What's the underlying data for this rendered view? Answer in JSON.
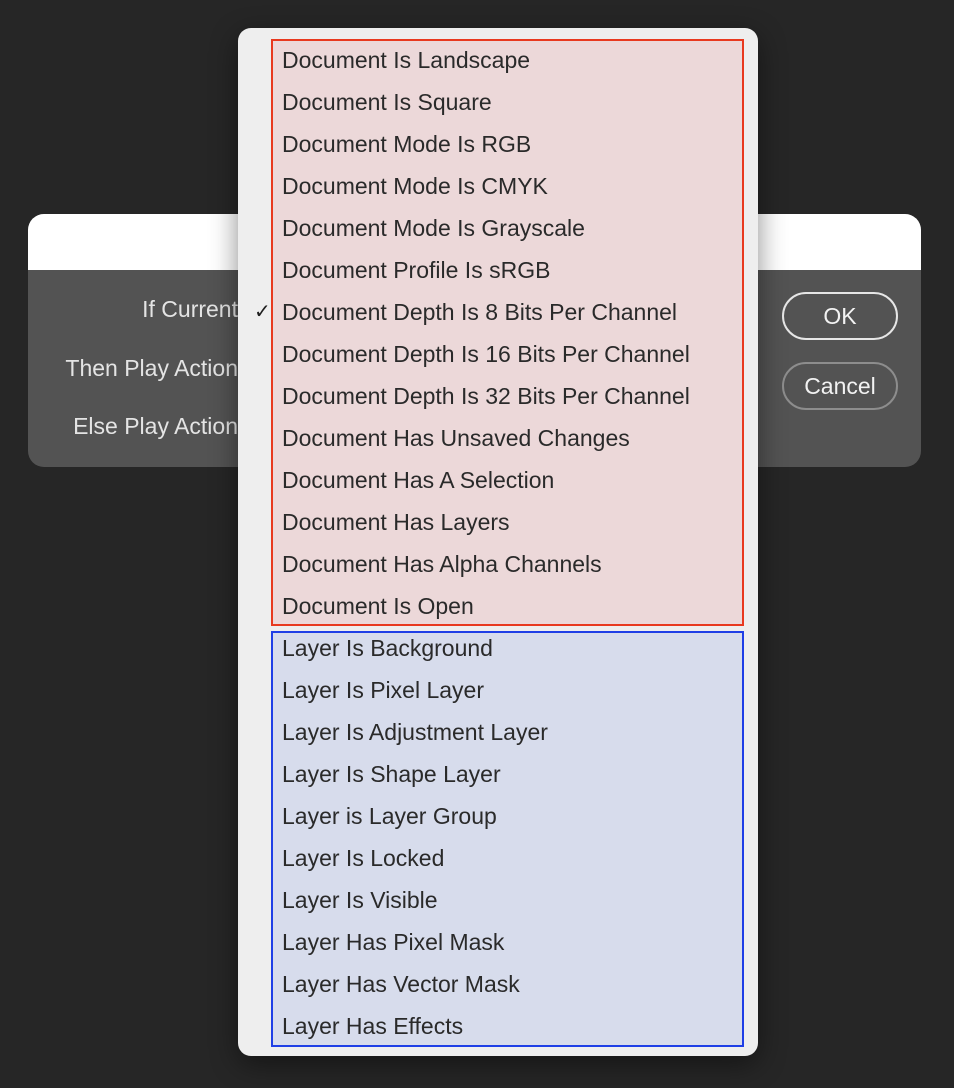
{
  "dialog": {
    "labels": {
      "if_current": "If Current",
      "then_play_action": "Then Play Action",
      "else_play_action": "Else Play Action"
    },
    "buttons": {
      "ok": "OK",
      "cancel": "Cancel"
    }
  },
  "menu": {
    "selected_index": 6,
    "checkmark_glyph": "✓",
    "document_items": [
      "Document Is Landscape",
      "Document Is Square",
      "Document Mode Is RGB",
      "Document Mode Is CMYK",
      "Document Mode Is Grayscale",
      "Document Profile Is sRGB",
      "Document Depth Is 8 Bits Per Channel",
      "Document Depth Is 16 Bits Per Channel",
      "Document Depth Is 32 Bits Per Channel",
      "Document Has Unsaved Changes",
      "Document Has A Selection",
      "Document Has Layers",
      "Document Has Alpha Channels",
      "Document Is Open"
    ],
    "layer_items": [
      "Layer Is Background",
      "Layer Is Pixel Layer",
      "Layer Is Adjustment Layer",
      "Layer Is Shape Layer",
      "Layer is Layer Group",
      "Layer Is Locked",
      "Layer Is Visible",
      "Layer Has Pixel Mask",
      "Layer Has Vector Mask",
      "Layer Has Effects"
    ],
    "highlight_colors": {
      "document_border": "#e8391f",
      "document_fill": "#ecd8d9",
      "layer_border": "#1f3fe6",
      "layer_fill": "#d7dcec"
    }
  }
}
